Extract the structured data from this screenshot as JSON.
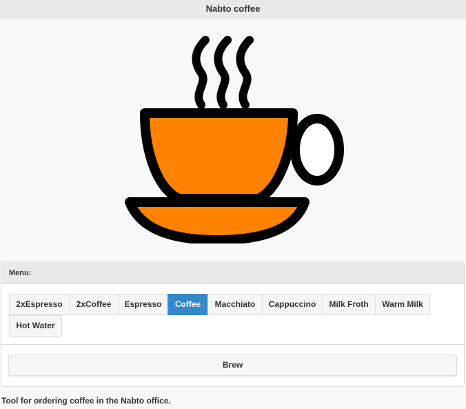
{
  "header": {
    "title": "Nabto coffee"
  },
  "hero": {
    "icon": "coffee-cup-icon",
    "cup_color": "#ff8200",
    "outline_color": "#000000"
  },
  "menu": {
    "title": "Menu:",
    "options": [
      {
        "label": "2xEspresso",
        "selected": false
      },
      {
        "label": "2xCoffee",
        "selected": false
      },
      {
        "label": "Espresso",
        "selected": false
      },
      {
        "label": "Coffee",
        "selected": true
      },
      {
        "label": "Macchiato",
        "selected": false
      },
      {
        "label": "Cappuccino",
        "selected": false
      },
      {
        "label": "Milk Froth",
        "selected": false
      },
      {
        "label": "Warm Milk",
        "selected": false
      },
      {
        "label": "Hot Water",
        "selected": false
      }
    ],
    "selected_color": "#3388cc"
  },
  "brew": {
    "label": "Brew"
  },
  "footer": {
    "text": "Tool for ordering coffee in the Nabto office."
  }
}
